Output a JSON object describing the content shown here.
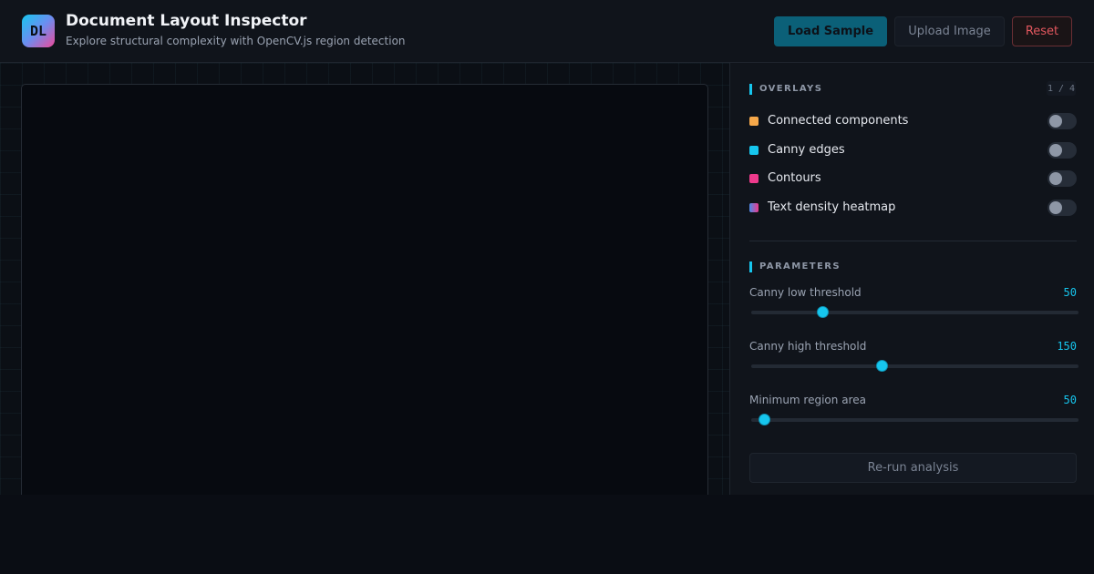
{
  "header": {
    "logo_text": "DL",
    "title": "Document Layout Inspector",
    "subtitle": "Explore structural complexity with OpenCV.js region detection",
    "buttons": {
      "load_sample": "Load Sample",
      "upload_image": "Upload Image",
      "reset": "Reset"
    }
  },
  "overlays": {
    "heading": "OVERLAYS",
    "counter": "1 / 4",
    "items": [
      {
        "label": "Connected components",
        "color": "#f6a84a",
        "enabled": false
      },
      {
        "label": "Canny edges",
        "color": "#16c6ee",
        "enabled": false
      },
      {
        "label": "Contours",
        "color": "#ee3a8c",
        "enabled": false
      },
      {
        "label": "Text density heatmap",
        "color": "#8a6fe0",
        "enabled": false
      }
    ]
  },
  "parameters": {
    "heading": "PARAMETERS",
    "items": [
      {
        "label": "Canny low threshold",
        "value": "50",
        "fraction": 0.22
      },
      {
        "label": "Canny high threshold",
        "value": "150",
        "fraction": 0.4
      },
      {
        "label": "Minimum region area",
        "value": "50",
        "fraction": 0.04
      }
    ],
    "rerun_label": "Re-run analysis"
  },
  "colors": {
    "accent": "#16c6ee",
    "reset": "#e2575e"
  }
}
